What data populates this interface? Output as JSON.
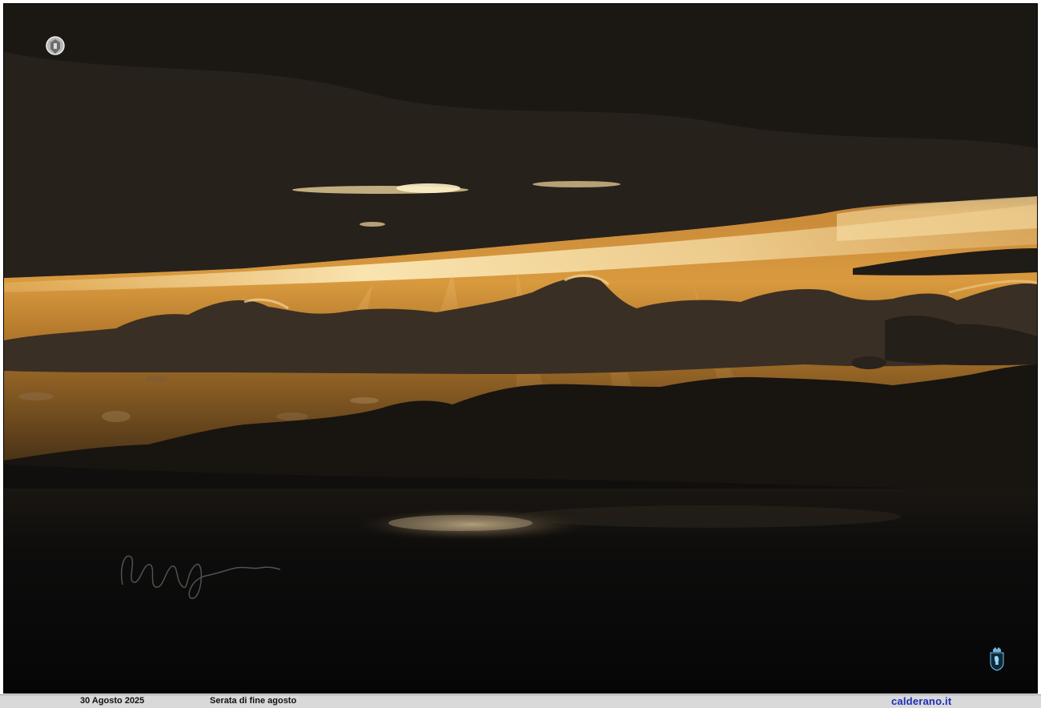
{
  "caption": {
    "date": "30 Agosto 2025",
    "title": "Serata di fine agosto",
    "site": "calderano.it"
  },
  "photo": {
    "scene": "sunset over sea with mountain silhouette",
    "colors": {
      "sky_glow": "#e8a23a",
      "cloud_dark": "#1e1a16",
      "sea": "#0b0b0c",
      "mountain": "#15120f"
    }
  },
  "marks": {
    "top_stamp_icon": "crest-watermark-icon",
    "bottom_stamp_icon": "lion-crest-icon",
    "signature_icon": "handwritten-signature"
  }
}
